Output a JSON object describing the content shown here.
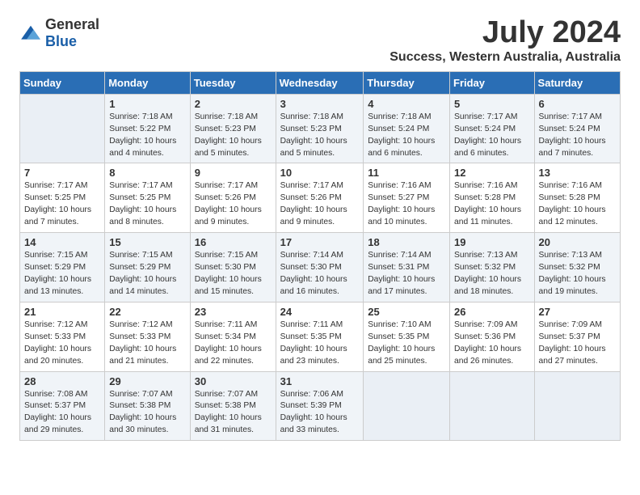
{
  "header": {
    "logo_general": "General",
    "logo_blue": "Blue",
    "month_year": "July 2024",
    "location": "Success, Western Australia, Australia"
  },
  "weekdays": [
    "Sunday",
    "Monday",
    "Tuesday",
    "Wednesday",
    "Thursday",
    "Friday",
    "Saturday"
  ],
  "weeks": [
    [
      {
        "day": "",
        "empty": true
      },
      {
        "day": "1",
        "sunrise": "7:18 AM",
        "sunset": "5:22 PM",
        "daylight": "10 hours and 4 minutes."
      },
      {
        "day": "2",
        "sunrise": "7:18 AM",
        "sunset": "5:23 PM",
        "daylight": "10 hours and 5 minutes."
      },
      {
        "day": "3",
        "sunrise": "7:18 AM",
        "sunset": "5:23 PM",
        "daylight": "10 hours and 5 minutes."
      },
      {
        "day": "4",
        "sunrise": "7:18 AM",
        "sunset": "5:24 PM",
        "daylight": "10 hours and 6 minutes."
      },
      {
        "day": "5",
        "sunrise": "7:17 AM",
        "sunset": "5:24 PM",
        "daylight": "10 hours and 6 minutes."
      },
      {
        "day": "6",
        "sunrise": "7:17 AM",
        "sunset": "5:24 PM",
        "daylight": "10 hours and 7 minutes."
      }
    ],
    [
      {
        "day": "7",
        "sunrise": "7:17 AM",
        "sunset": "5:25 PM",
        "daylight": "10 hours and 7 minutes."
      },
      {
        "day": "8",
        "sunrise": "7:17 AM",
        "sunset": "5:25 PM",
        "daylight": "10 hours and 8 minutes."
      },
      {
        "day": "9",
        "sunrise": "7:17 AM",
        "sunset": "5:26 PM",
        "daylight": "10 hours and 9 minutes."
      },
      {
        "day": "10",
        "sunrise": "7:17 AM",
        "sunset": "5:26 PM",
        "daylight": "10 hours and 9 minutes."
      },
      {
        "day": "11",
        "sunrise": "7:16 AM",
        "sunset": "5:27 PM",
        "daylight": "10 hours and 10 minutes."
      },
      {
        "day": "12",
        "sunrise": "7:16 AM",
        "sunset": "5:28 PM",
        "daylight": "10 hours and 11 minutes."
      },
      {
        "day": "13",
        "sunrise": "7:16 AM",
        "sunset": "5:28 PM",
        "daylight": "10 hours and 12 minutes."
      }
    ],
    [
      {
        "day": "14",
        "sunrise": "7:15 AM",
        "sunset": "5:29 PM",
        "daylight": "10 hours and 13 minutes."
      },
      {
        "day": "15",
        "sunrise": "7:15 AM",
        "sunset": "5:29 PM",
        "daylight": "10 hours and 14 minutes."
      },
      {
        "day": "16",
        "sunrise": "7:15 AM",
        "sunset": "5:30 PM",
        "daylight": "10 hours and 15 minutes."
      },
      {
        "day": "17",
        "sunrise": "7:14 AM",
        "sunset": "5:30 PM",
        "daylight": "10 hours and 16 minutes."
      },
      {
        "day": "18",
        "sunrise": "7:14 AM",
        "sunset": "5:31 PM",
        "daylight": "10 hours and 17 minutes."
      },
      {
        "day": "19",
        "sunrise": "7:13 AM",
        "sunset": "5:32 PM",
        "daylight": "10 hours and 18 minutes."
      },
      {
        "day": "20",
        "sunrise": "7:13 AM",
        "sunset": "5:32 PM",
        "daylight": "10 hours and 19 minutes."
      }
    ],
    [
      {
        "day": "21",
        "sunrise": "7:12 AM",
        "sunset": "5:33 PM",
        "daylight": "10 hours and 20 minutes."
      },
      {
        "day": "22",
        "sunrise": "7:12 AM",
        "sunset": "5:33 PM",
        "daylight": "10 hours and 21 minutes."
      },
      {
        "day": "23",
        "sunrise": "7:11 AM",
        "sunset": "5:34 PM",
        "daylight": "10 hours and 22 minutes."
      },
      {
        "day": "24",
        "sunrise": "7:11 AM",
        "sunset": "5:35 PM",
        "daylight": "10 hours and 23 minutes."
      },
      {
        "day": "25",
        "sunrise": "7:10 AM",
        "sunset": "5:35 PM",
        "daylight": "10 hours and 25 minutes."
      },
      {
        "day": "26",
        "sunrise": "7:09 AM",
        "sunset": "5:36 PM",
        "daylight": "10 hours and 26 minutes."
      },
      {
        "day": "27",
        "sunrise": "7:09 AM",
        "sunset": "5:37 PM",
        "daylight": "10 hours and 27 minutes."
      }
    ],
    [
      {
        "day": "28",
        "sunrise": "7:08 AM",
        "sunset": "5:37 PM",
        "daylight": "10 hours and 29 minutes."
      },
      {
        "day": "29",
        "sunrise": "7:07 AM",
        "sunset": "5:38 PM",
        "daylight": "10 hours and 30 minutes."
      },
      {
        "day": "30",
        "sunrise": "7:07 AM",
        "sunset": "5:38 PM",
        "daylight": "10 hours and 31 minutes."
      },
      {
        "day": "31",
        "sunrise": "7:06 AM",
        "sunset": "5:39 PM",
        "daylight": "10 hours and 33 minutes."
      },
      {
        "day": "",
        "empty": true
      },
      {
        "day": "",
        "empty": true
      },
      {
        "day": "",
        "empty": true
      }
    ]
  ]
}
